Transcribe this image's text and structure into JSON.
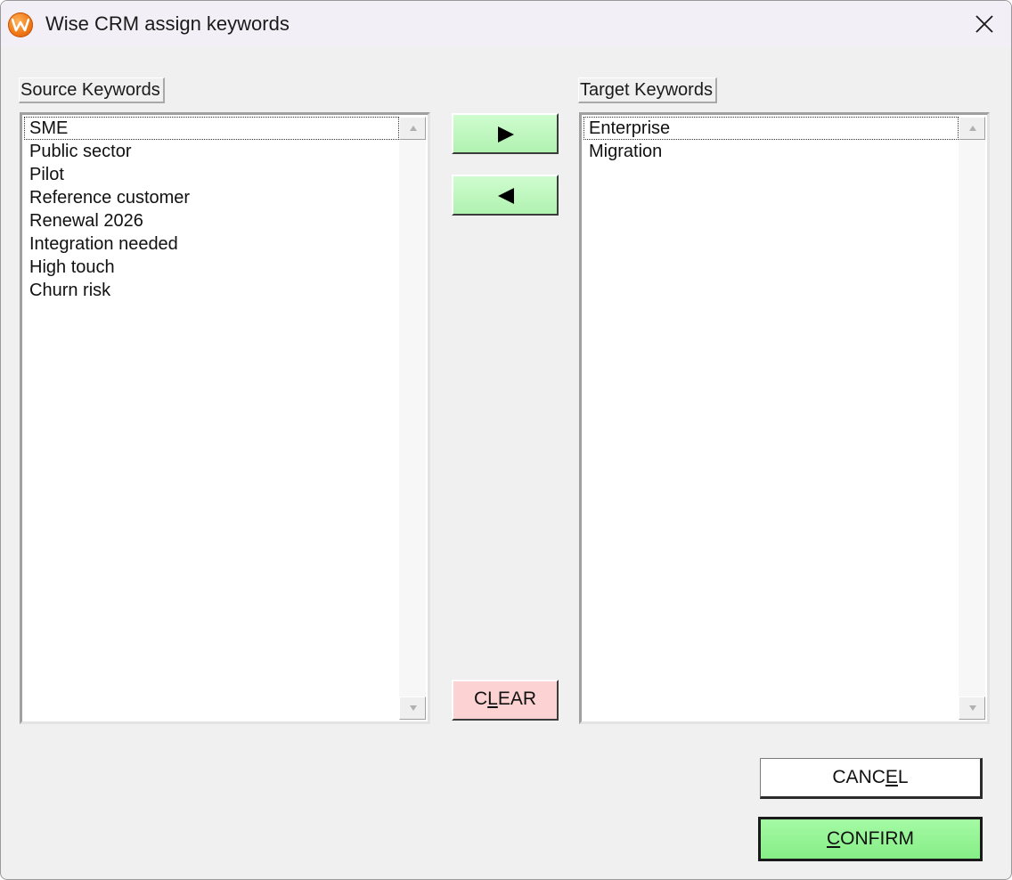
{
  "window": {
    "title": "Wise CRM assign keywords",
    "app_icon": "wise-crm-logo-icon",
    "close_icon": "close-icon"
  },
  "source": {
    "label": "Source Keywords",
    "items": [
      "SME",
      "Public sector",
      "Pilot",
      "Reference customer",
      "Renewal 2026",
      "Integration needed",
      "High touch",
      "Churn risk"
    ],
    "focused_index": 0
  },
  "target": {
    "label": "Target Keywords",
    "items": [
      "Enterprise",
      "Migration"
    ],
    "focused_index": 0
  },
  "buttons": {
    "move_right_icon": "triangle-right-icon",
    "move_left_icon": "triangle-left-icon",
    "clear": {
      "pre": "C",
      "accel": "L",
      "post": "EAR"
    },
    "cancel": {
      "pre": "CANC",
      "accel": "E",
      "post": "L"
    },
    "confirm": {
      "pre": "",
      "accel": "C",
      "post": "ONFIRM"
    }
  },
  "colors": {
    "move_button": "#b8f5b8",
    "clear_button": "#fcd2d2",
    "confirm_button": "#90f090",
    "window_bg": "#f0f0f0",
    "titlebar_bg": "#f3eff6"
  }
}
